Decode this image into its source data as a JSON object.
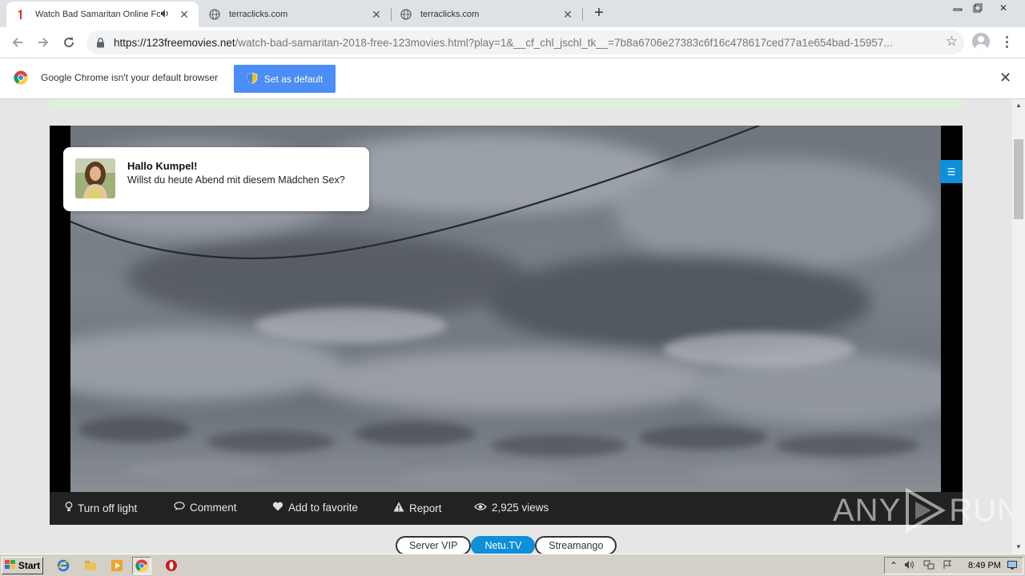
{
  "tabs": [
    {
      "title": "Watch Bad Samaritan Online For",
      "active": true,
      "favicon": "one-icon",
      "audio": true
    },
    {
      "title": "terraclicks.com",
      "active": false,
      "favicon": "globe-icon"
    },
    {
      "title": "terraclicks.com",
      "active": false,
      "favicon": "globe-icon"
    }
  ],
  "toolbar": {
    "url_host": "https://123freemovies.net",
    "url_rest": "/watch-bad-samaritan-2018-free-123movies.html?play=1&__cf_chl_jschl_tk__=7b8a6706e27383c6f16c478617ced77a1e654bad-15957..."
  },
  "infobar": {
    "message": "Google Chrome isn't your default browser",
    "button": "Set as default"
  },
  "notification": {
    "title": "Hallo Kumpel!",
    "body": "Willst du heute Abend mit diesem Mädchen Sex?"
  },
  "player": {
    "controls": {
      "light": "Turn off light",
      "comment": "Comment",
      "favorite": "Add to favorite",
      "report": "Report",
      "views": "2,925 views"
    },
    "watermark": {
      "left": "ANY",
      "right": "RUN"
    }
  },
  "servers": [
    {
      "label": "Server VIP",
      "active": false
    },
    {
      "label": "Netu.TV",
      "active": true
    },
    {
      "label": "Streamango",
      "active": false
    }
  ],
  "taskbar": {
    "start": "Start",
    "clock": "8:49 PM"
  },
  "colors": {
    "accent": "#0e8fd8",
    "set_default_button": "#4c8df6",
    "tabstrip": "#dee1e6"
  }
}
